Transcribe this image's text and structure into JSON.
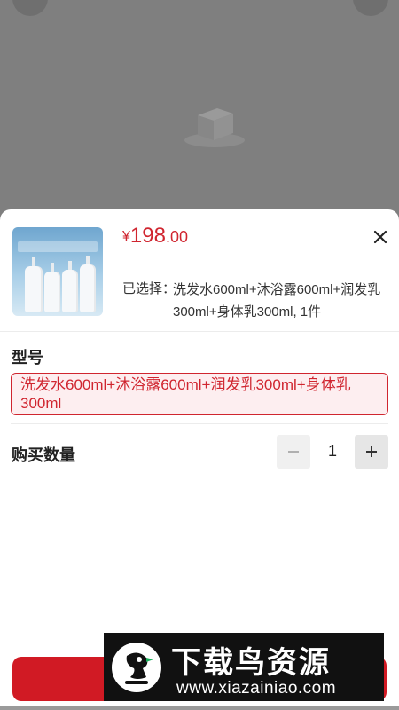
{
  "product": {
    "price_currency": "¥",
    "price_integer": "198",
    "price_decimal": ".00",
    "thumbnail_caption": "洗护四件套",
    "selected_label": "已选择：",
    "selected_value": "洗发水600ml+沐浴露600ml+润发乳300ml+身体乳300ml, 1件"
  },
  "spec": {
    "title": "型号",
    "option": "洗发水600ml+沐浴露600ml+润发乳300ml+身体乳300ml"
  },
  "quantity": {
    "title": "购买数量",
    "minus": "−",
    "value": "1",
    "plus": "+"
  },
  "watermark": {
    "title": "下载鸟资源",
    "url": "www.xiazainiao.com"
  },
  "icons": {
    "close": "close-icon",
    "minus": "minus-icon",
    "plus": "plus-icon"
  },
  "colors": {
    "accent": "#d0252f",
    "button": "#d11a24",
    "option_bg": "#fdeef0"
  }
}
